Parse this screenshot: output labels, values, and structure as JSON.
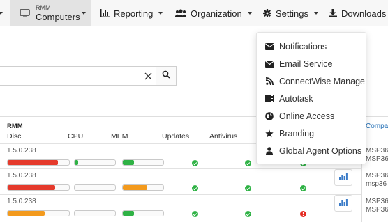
{
  "nav": {
    "computers": {
      "small_label": "RMM",
      "label": "Computers",
      "icon": "monitor-icon"
    },
    "reporting": {
      "label": "Reporting",
      "icon": "bar-chart-icon"
    },
    "organization": {
      "label": "Organization",
      "icon": "users-icon"
    },
    "settings": {
      "label": "Settings",
      "icon": "gear-icon"
    },
    "downloads": {
      "label": "Downloads",
      "icon": "download-icon"
    }
  },
  "search": {
    "value": "",
    "placeholder": ""
  },
  "settings_menu": {
    "items": [
      {
        "label": "Notifications",
        "icon": "envelope-icon"
      },
      {
        "label": "Email Service",
        "icon": "envelope-icon"
      },
      {
        "label": "ConnectWise Manage",
        "icon": "rss-icon"
      },
      {
        "label": "Autotask",
        "icon": "server-icon"
      },
      {
        "label": "Online Access",
        "icon": "globe-icon"
      },
      {
        "label": "Branding",
        "icon": "star-icon"
      },
      {
        "label": "Global Agent Options",
        "icon": "user-icon"
      }
    ]
  },
  "table": {
    "group_header": "RMM",
    "columns": {
      "disc": "Disc",
      "cpu": "CPU",
      "mem": "MEM",
      "updates": "Updates",
      "antivirus": "Antivirus",
      "company": "Compa"
    },
    "rows": [
      {
        "version": "1.5.0.238",
        "disc": 0.82,
        "cpu": 0.08,
        "mem": 0.27,
        "updates": "ok",
        "antivirus": "ok",
        "status3": "ok",
        "company": [
          "MSP36",
          "MSP36"
        ]
      },
      {
        "version": "1.5.0.238",
        "disc": 0.77,
        "cpu": 0.02,
        "mem": 0.6,
        "updates": "ok",
        "antivirus": "ok",
        "status3": "ok",
        "company": [
          "MSP36",
          "msp36"
        ]
      },
      {
        "version": "1.5.0.238",
        "disc": 0.6,
        "cpu": 0.02,
        "mem": 0.27,
        "updates": "ok",
        "antivirus": "ok",
        "status3": "error",
        "company": [
          "MSP36",
          "MSP36"
        ]
      }
    ]
  },
  "colors": {
    "red": "#e53a2c",
    "green": "#2fb245",
    "orange": "#f39a1d",
    "chart_icon": "#3a7bc8",
    "link": "#1f6db5"
  }
}
